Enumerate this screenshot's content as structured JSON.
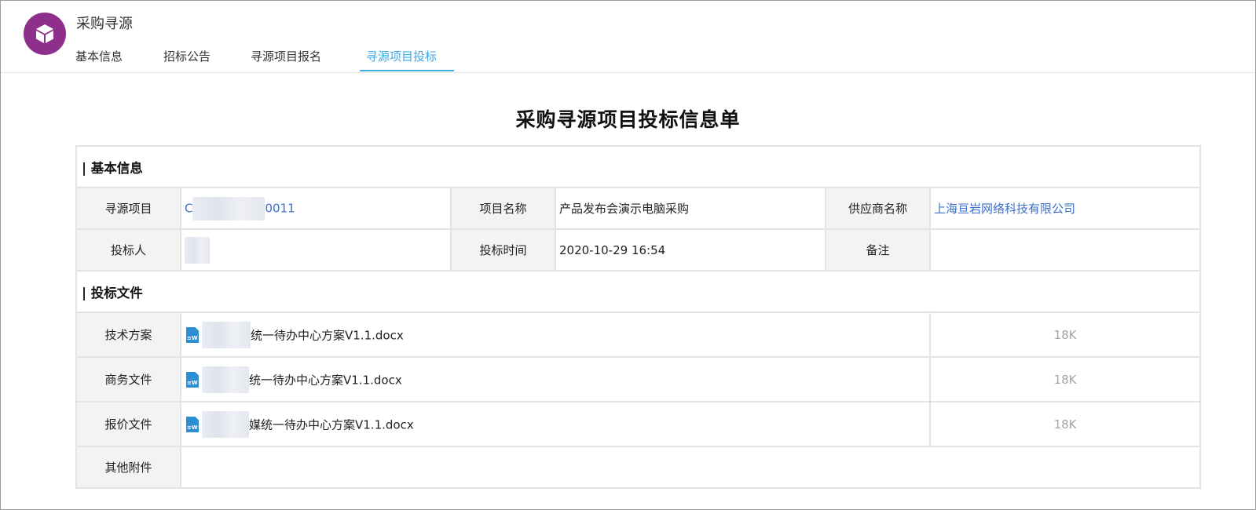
{
  "app": {
    "title": "采购寻源",
    "logo_icon": "cube-icon",
    "logo_color": "#8e2f8b"
  },
  "tabs": [
    {
      "label": "基本信息",
      "active": false
    },
    {
      "label": "招标公告",
      "active": false
    },
    {
      "label": "寻源项目报名",
      "active": false
    },
    {
      "label": "寻源项目投标",
      "active": true
    }
  ],
  "accent_color": "#3ea9e3",
  "document": {
    "title": "采购寻源项目投标信息单"
  },
  "basic_info": {
    "section_title": "| 基本信息",
    "sourcing_project_label": "寻源项目",
    "sourcing_project_prefix": "C",
    "sourcing_project_suffix": "0011",
    "project_name_label": "项目名称",
    "project_name_value": "产品发布会演示电脑采购",
    "supplier_label": "供应商名称",
    "supplier_value": "上海亘岩网络科技有限公司",
    "bidder_label": "投标人",
    "bid_time_label": "投标时间",
    "bid_time_value": "2020-10-29 16:54",
    "remark_label": "备注",
    "remark_value": ""
  },
  "bid_files": {
    "section_title": "| 投标文件",
    "rows": [
      {
        "label": "技术方案",
        "file_name": "统一待办中心方案V1.1.docx",
        "file_icon": "word-doc-icon",
        "size": "18K"
      },
      {
        "label": "商务文件",
        "file_name": "统一待办中心方案V1.1.docx",
        "file_icon": "word-doc-icon",
        "size": "18K"
      },
      {
        "label": "报价文件",
        "file_name": "媒统一待办中心方案V1.1.docx",
        "file_icon": "word-doc-icon",
        "size": "18K"
      }
    ],
    "other_label": "其他附件"
  }
}
